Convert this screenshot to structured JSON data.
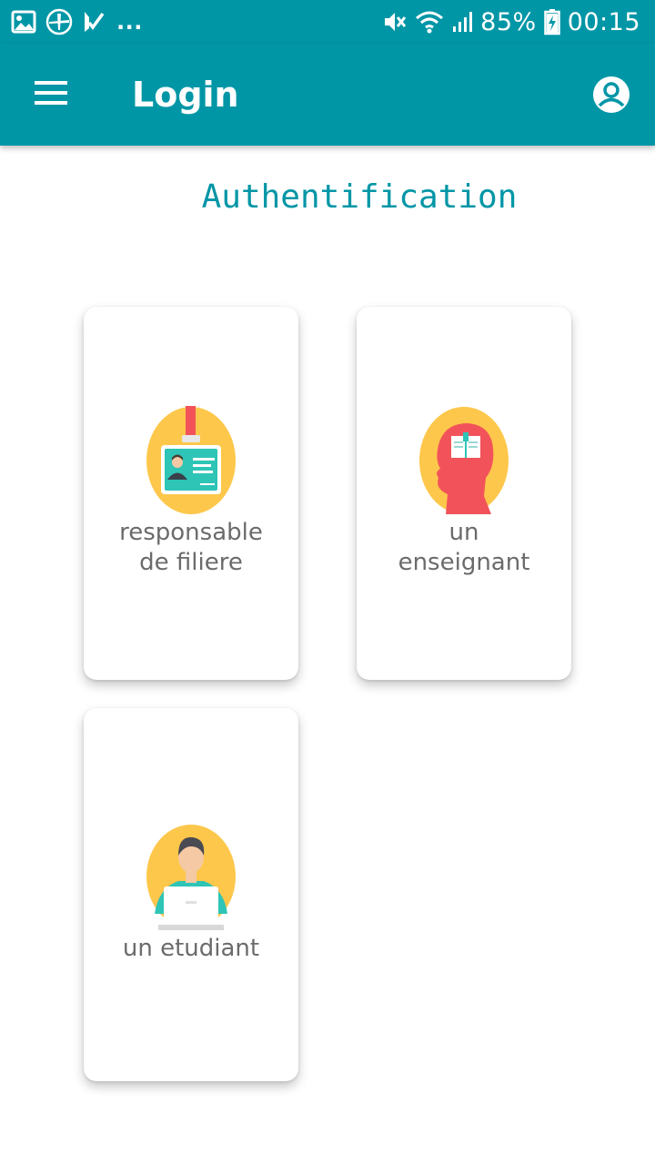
{
  "status_bar": {
    "battery": "85%",
    "time": "00:15",
    "overflow": "..."
  },
  "app_bar": {
    "title": "Login"
  },
  "page": {
    "heading": "Authentification"
  },
  "cards": [
    {
      "id": "responsable",
      "label_line1": "responsable",
      "label_line2": "de filiere",
      "icon": "id-badge-icon"
    },
    {
      "id": "enseignant",
      "label_line1": "un",
      "label_line2": "enseignant",
      "icon": "head-book-icon"
    },
    {
      "id": "etudiant",
      "label_line1": "un etudiant",
      "icon": "student-laptop-icon"
    }
  ],
  "colors": {
    "primary": "#0096a6",
    "avatar_bg": "#fdc74b",
    "label_text": "#6b6b6b",
    "accent_red": "#f2535a",
    "accent_teal": "#2ec4b6"
  }
}
